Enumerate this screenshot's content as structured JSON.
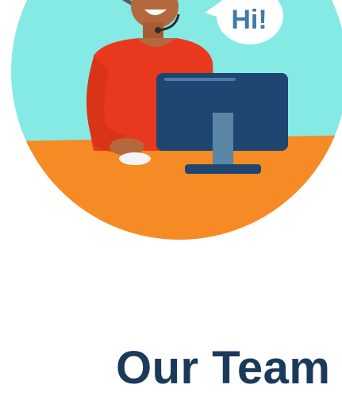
{
  "hero": {
    "speech_bubble_text": "Hi!",
    "icon": "support-agent-illustration"
  },
  "section": {
    "heading": "Our Team"
  },
  "colors": {
    "background": "#ffffff",
    "circle_sky": "#86eae4",
    "desk": "#f68a25",
    "shirt": "#e8391f",
    "monitor": "#1e4670",
    "heading": "#1b3a5a"
  }
}
